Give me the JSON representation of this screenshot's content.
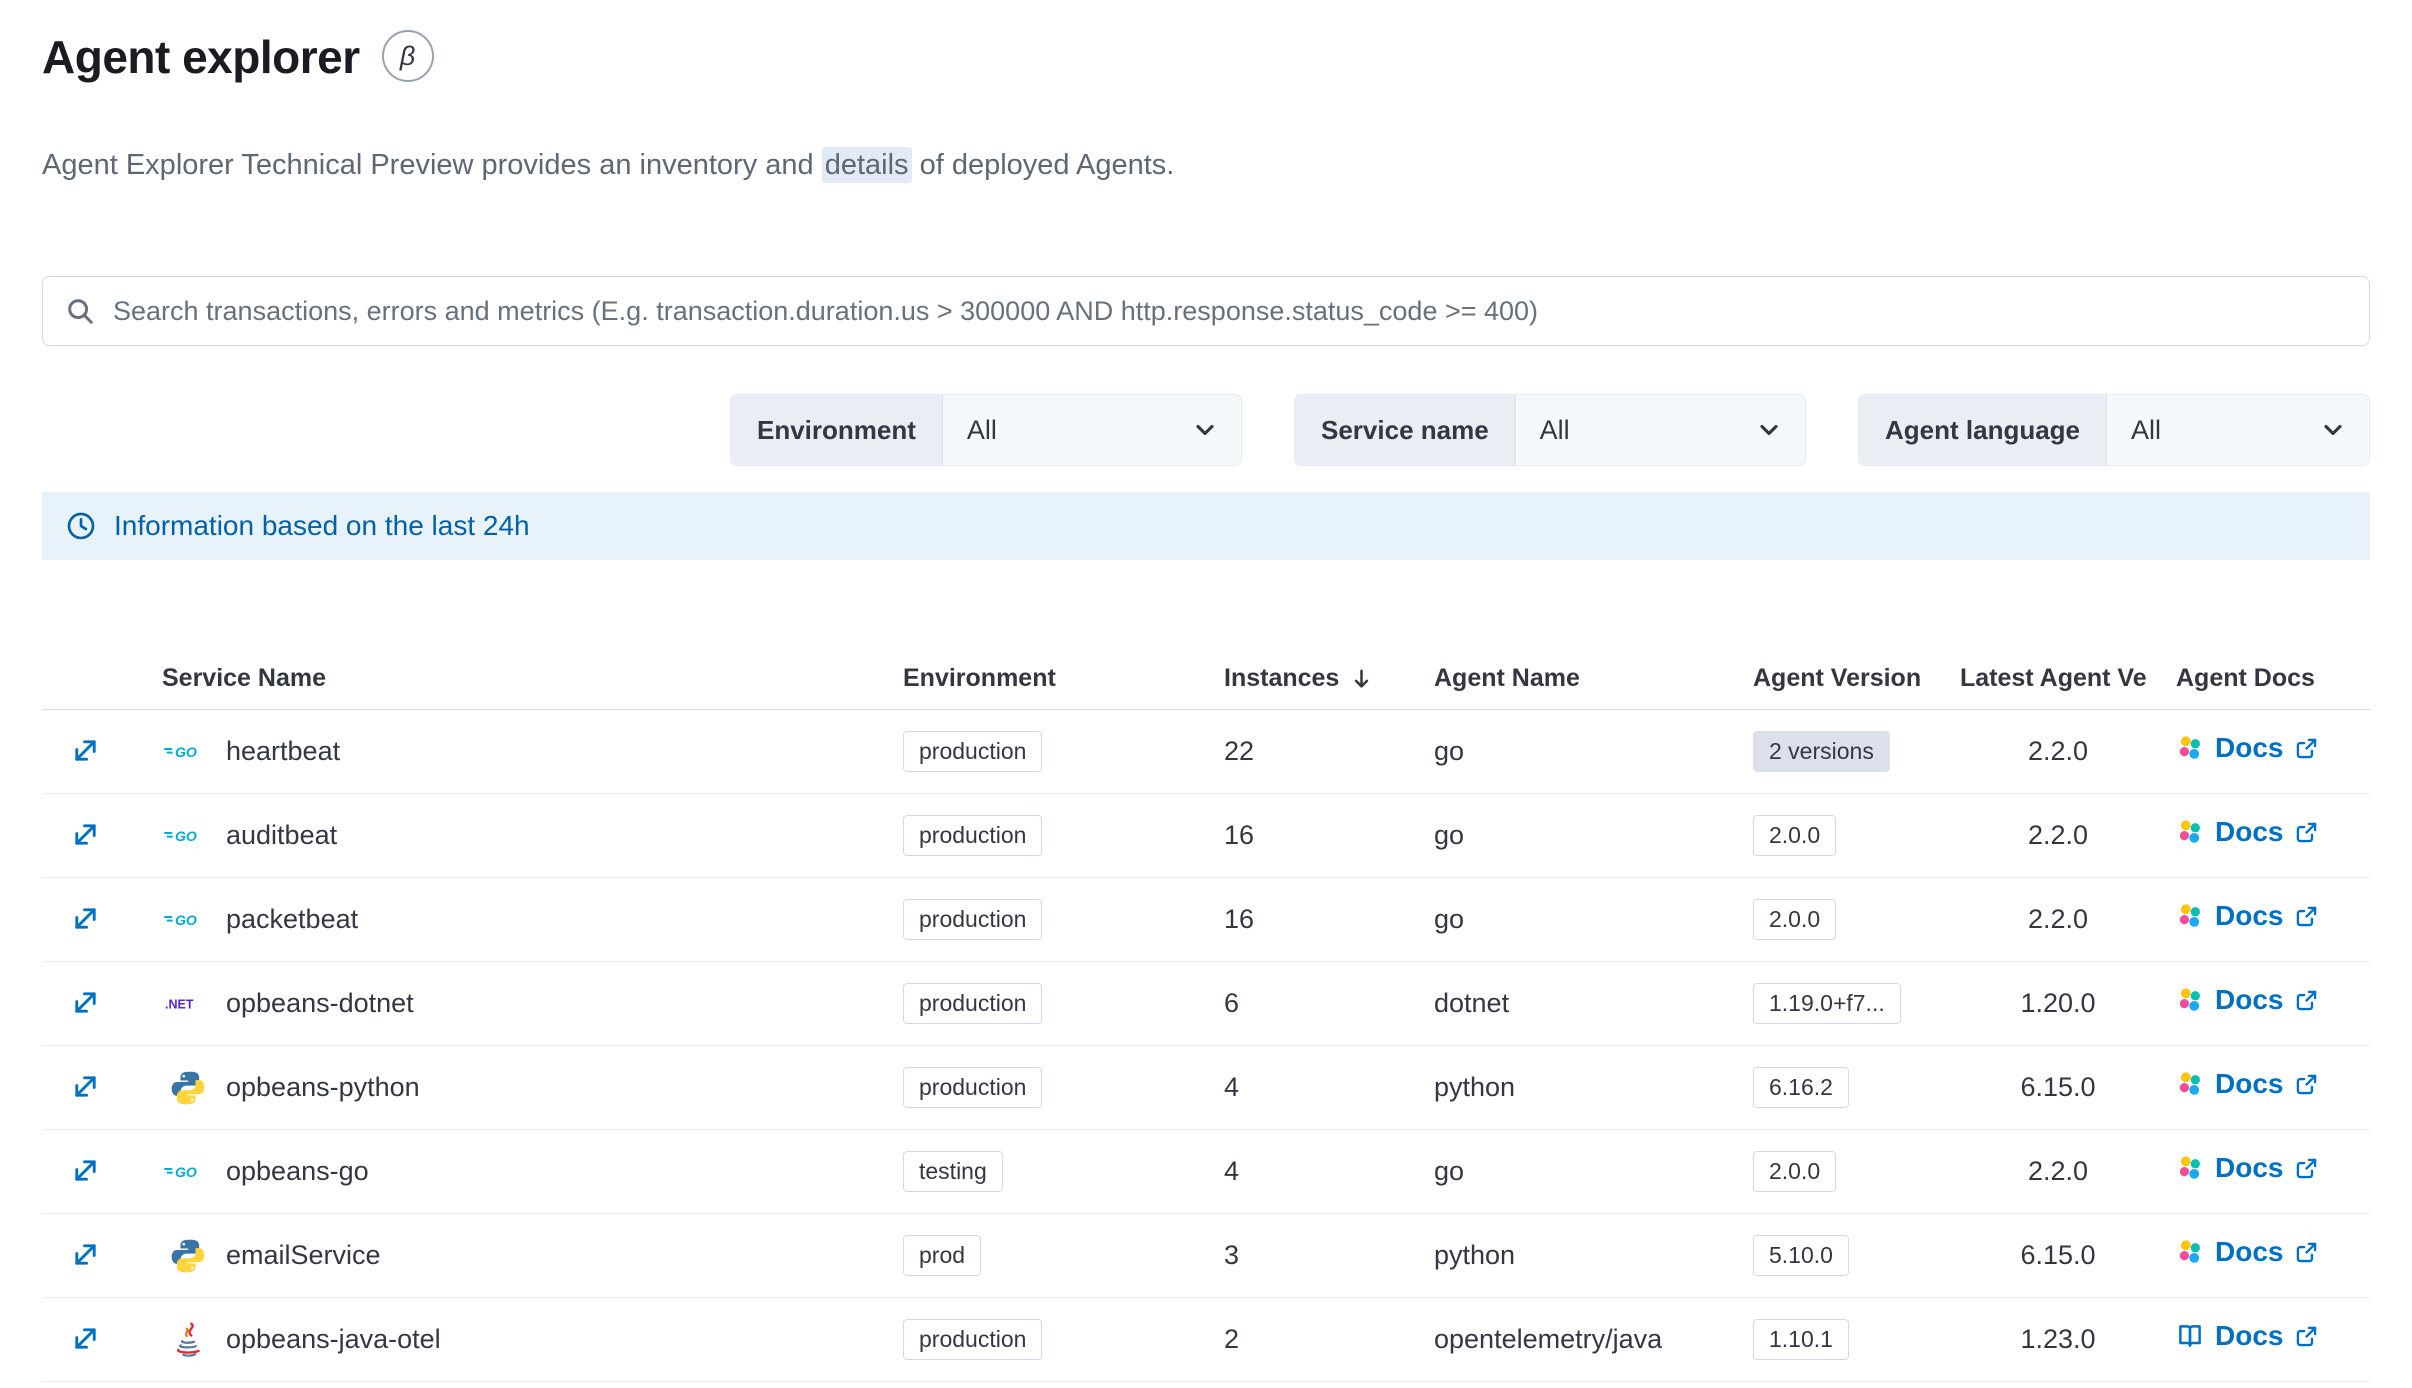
{
  "colors": {
    "text": "#343741",
    "subtle": "#5f6774",
    "link": "#0071c2",
    "border": "#d3dae6",
    "row_border": "#e8ecf3",
    "callout_bg": "#e8f2fb",
    "callout_text": "#0061a6",
    "badge_filled": "#dbe0eb",
    "hl": "#e1eaf6"
  },
  "page": {
    "title": "Agent explorer",
    "beta_badge": "β",
    "subtitle": {
      "pre": "Agent Explorer Technical Preview provides an inventory and ",
      "highlight": "details",
      "post": " of deployed Agents."
    }
  },
  "search": {
    "placeholder": "Search transactions, errors and metrics (E.g. transaction.duration.us > 300000 AND http.response.status_code >= 400)"
  },
  "filters": [
    {
      "label": "Environment",
      "value": "All"
    },
    {
      "label": "Service name",
      "value": "All"
    },
    {
      "label": "Agent language",
      "value": "All"
    }
  ],
  "callout": {
    "text": "Information based on the last 24h"
  },
  "table": {
    "docs_label": "Docs",
    "columns": [
      {
        "label": "Service Name"
      },
      {
        "label": "Environment"
      },
      {
        "label": "Instances",
        "sorted": "desc"
      },
      {
        "label": "Agent Name"
      },
      {
        "label": "Agent Version"
      },
      {
        "label": "Latest Agent Ve"
      },
      {
        "label": "Agent Docs"
      }
    ],
    "rows": [
      {
        "service": "heartbeat",
        "language_icon": "go",
        "environment": "production",
        "instances": "22",
        "agent_name": "go",
        "agent_version": {
          "text": "2 versions",
          "variant": "filled"
        },
        "latest_version": "2.2.0",
        "docs_icon": "elastic-agent"
      },
      {
        "service": "auditbeat",
        "language_icon": "go",
        "environment": "production",
        "instances": "16",
        "agent_name": "go",
        "agent_version": {
          "text": "2.0.0",
          "variant": "hollow"
        },
        "latest_version": "2.2.0",
        "docs_icon": "elastic-agent"
      },
      {
        "service": "packetbeat",
        "language_icon": "go",
        "environment": "production",
        "instances": "16",
        "agent_name": "go",
        "agent_version": {
          "text": "2.0.0",
          "variant": "hollow"
        },
        "latest_version": "2.2.0",
        "docs_icon": "elastic-agent"
      },
      {
        "service": "opbeans-dotnet",
        "language_icon": "dotnet",
        "environment": "production",
        "instances": "6",
        "agent_name": "dotnet",
        "agent_version": {
          "text": "1.19.0+f7...",
          "variant": "hollow"
        },
        "latest_version": "1.20.0",
        "docs_icon": "elastic-agent"
      },
      {
        "service": "opbeans-python",
        "language_icon": "python",
        "environment": "production",
        "instances": "4",
        "agent_name": "python",
        "agent_version": {
          "text": "6.16.2",
          "variant": "hollow"
        },
        "latest_version": "6.15.0",
        "docs_icon": "elastic-agent"
      },
      {
        "service": "opbeans-go",
        "language_icon": "go",
        "environment": "testing",
        "instances": "4",
        "agent_name": "go",
        "agent_version": {
          "text": "2.0.0",
          "variant": "hollow"
        },
        "latest_version": "2.2.0",
        "docs_icon": "elastic-agent"
      },
      {
        "service": "emailService",
        "language_icon": "python",
        "environment": "prod",
        "instances": "3",
        "agent_name": "python",
        "agent_version": {
          "text": "5.10.0",
          "variant": "hollow"
        },
        "latest_version": "6.15.0",
        "docs_icon": "elastic-agent"
      },
      {
        "service": "opbeans-java-otel",
        "language_icon": "java",
        "environment": "production",
        "instances": "2",
        "agent_name": "opentelemetry/java",
        "agent_version": {
          "text": "1.10.1",
          "variant": "hollow"
        },
        "latest_version": "1.23.0",
        "docs_icon": "book"
      }
    ]
  }
}
